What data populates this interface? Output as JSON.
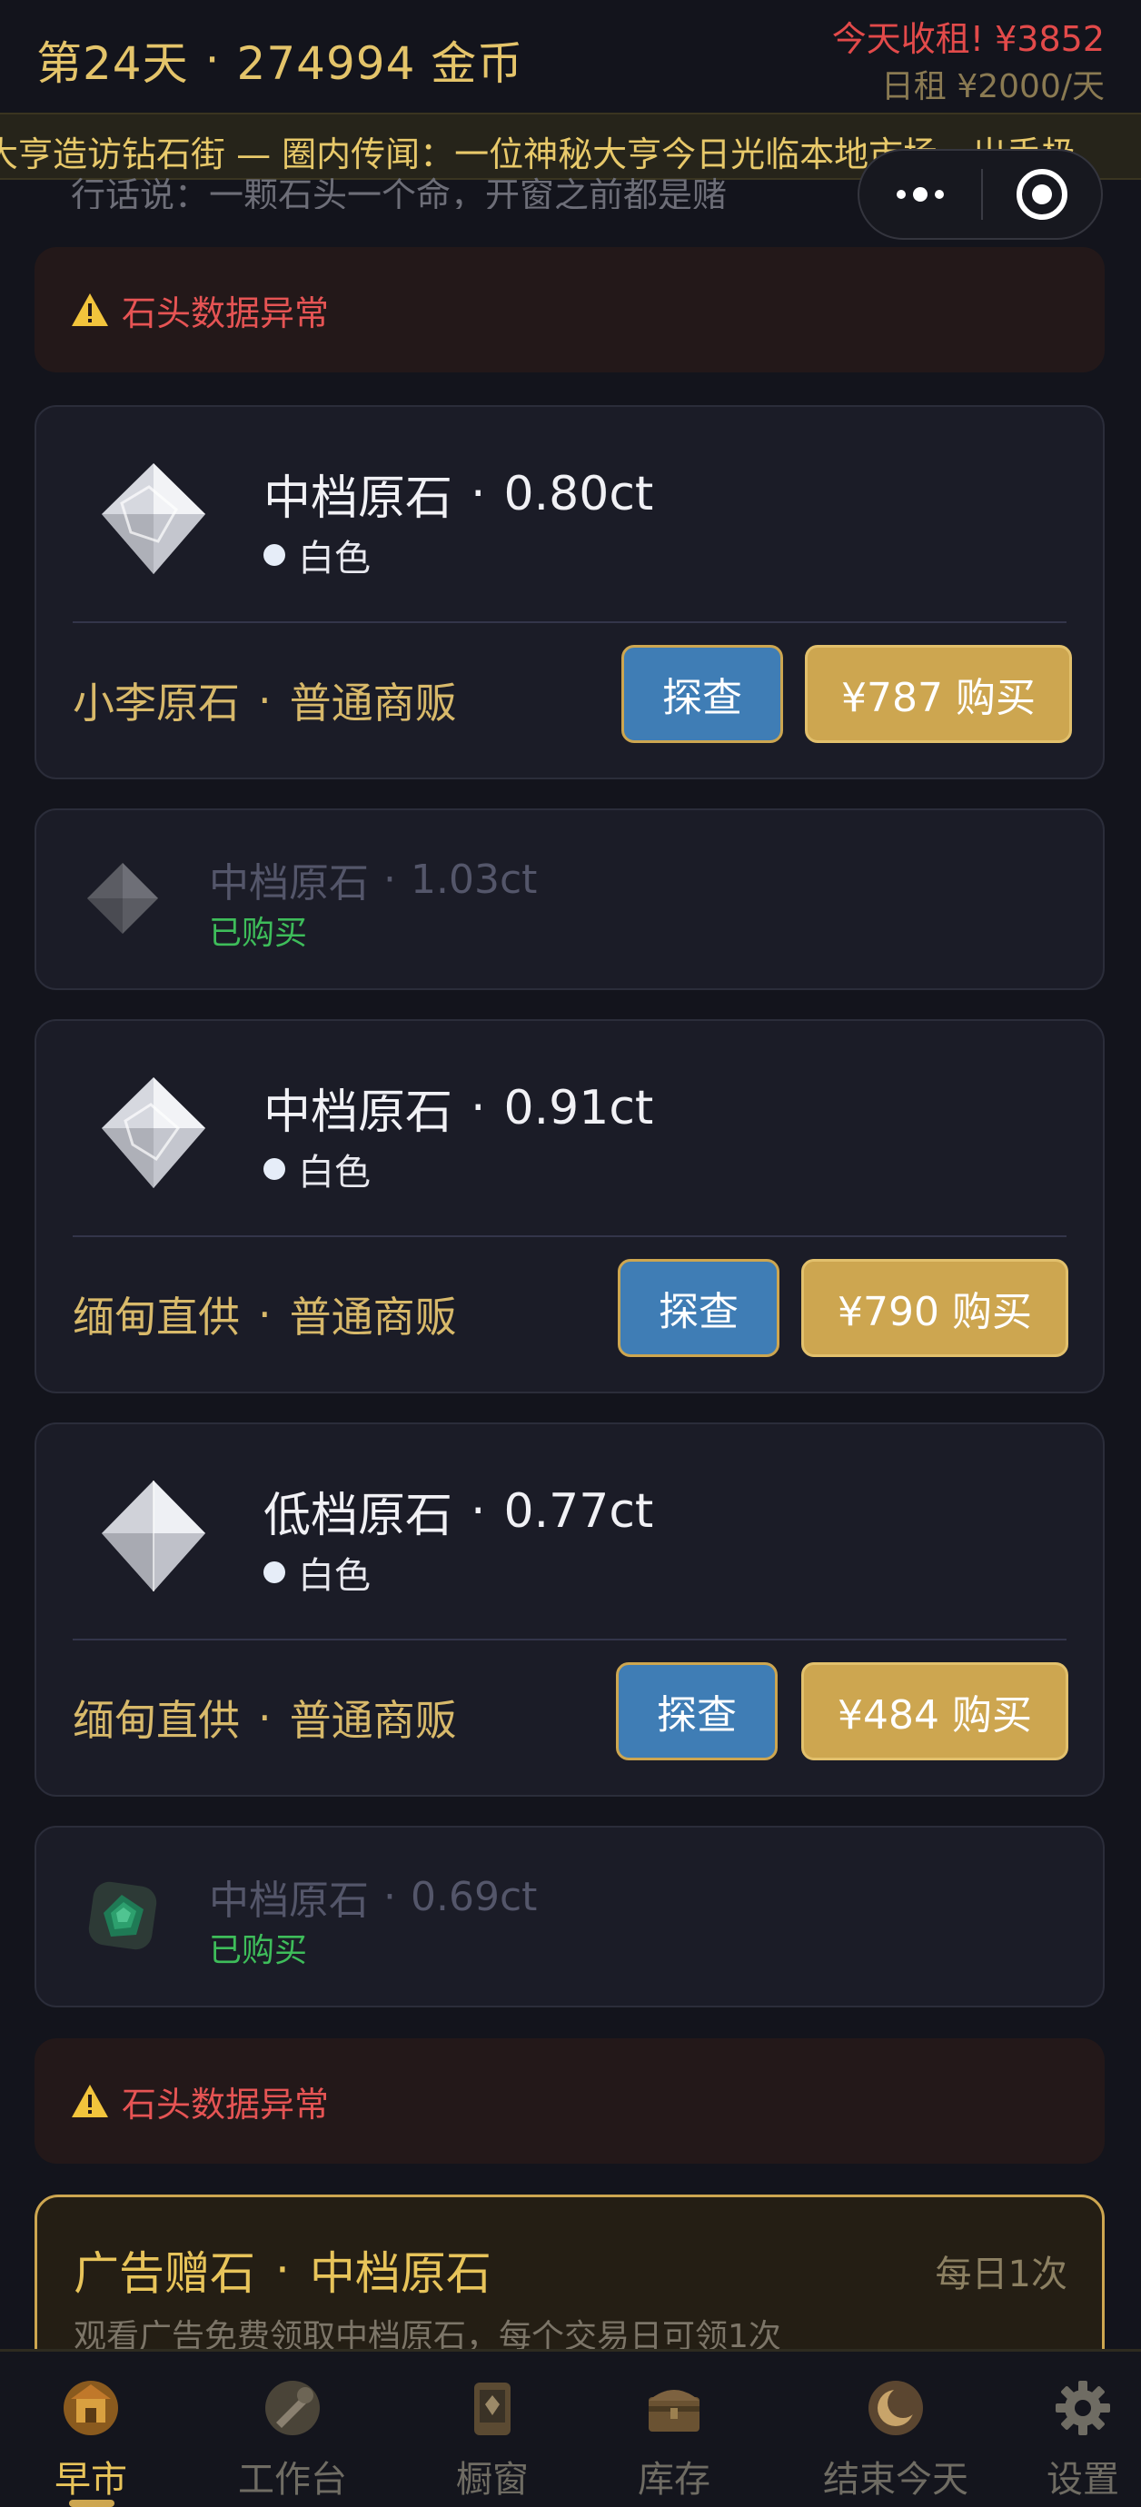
{
  "header": {
    "day_label": "第24天",
    "coins_label": "274994 金币",
    "rent_due": "今天收租! ¥3852",
    "rent_daily": "日租 ¥2000/天"
  },
  "ticker": {
    "text": "大亨造访钻石街 — 圈内传闻：一位神秘大亨今日光临本地市场，出手极",
    "sub_text": "行话说：一颗石头一个命，开窗之前都是赌"
  },
  "alerts": [
    {
      "text": "石头数据异常"
    },
    {
      "text": "石头数据异常"
    }
  ],
  "stones": [
    {
      "grade": "中档原石",
      "carat": "0.80ct",
      "color": "白色",
      "seller": "小李原石",
      "seller_type": "普通商贩",
      "scout_label": "探查",
      "buy_label": "¥787 购买"
    },
    {
      "grade": "中档原石",
      "carat": "1.03ct",
      "status": "已购买"
    },
    {
      "grade": "中档原石",
      "carat": "0.91ct",
      "color": "白色",
      "seller": "缅甸直供",
      "seller_type": "普通商贩",
      "scout_label": "探查",
      "buy_label": "¥790 购买"
    },
    {
      "grade": "低档原石",
      "carat": "0.77ct",
      "color": "白色",
      "seller": "缅甸直供",
      "seller_type": "普通商贩",
      "scout_label": "探查",
      "buy_label": "¥484 购买"
    },
    {
      "grade": "中档原石",
      "carat": "0.69ct",
      "status": "已购买"
    }
  ],
  "ad": {
    "prefix": "广告赠石",
    "grade": "中档原石",
    "limit": "每日1次",
    "desc": "观看广告免费领取中档原石，每个交易日可领1次"
  },
  "tabs": [
    {
      "label": "早市",
      "icon": "market-icon"
    },
    {
      "label": "工作台",
      "icon": "workbench-icon"
    },
    {
      "label": "橱窗",
      "icon": "showcase-icon"
    },
    {
      "label": "库存",
      "icon": "inventory-chest-icon"
    },
    {
      "label": "结束今天",
      "icon": "moon-end-day-icon"
    },
    {
      "label": "设置",
      "icon": "gear-icon"
    }
  ],
  "separator": "·"
}
